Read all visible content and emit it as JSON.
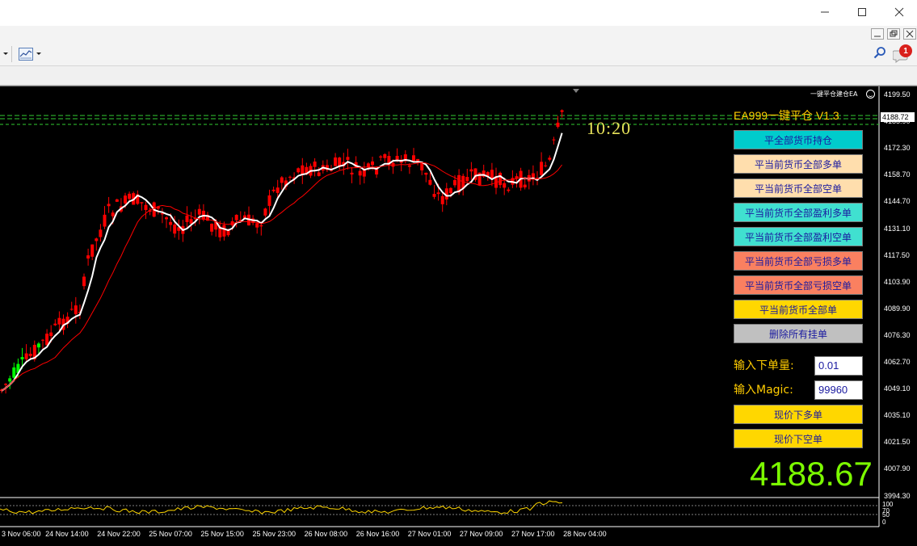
{
  "window": {
    "minimize_label": "—",
    "maximize_label": "☐",
    "close_label": "✕"
  },
  "toolbar": {
    "chart_type_icon": "line-chart-icon",
    "search_icon": "search-icon",
    "notifications_count": "1"
  },
  "chart": {
    "price_ticks": [
      "4199.50",
      "4185.90",
      "4172.30",
      "4158.70",
      "4144.70",
      "4131.10",
      "4117.50",
      "4103.90",
      "4089.90",
      "4076.30",
      "4062.70",
      "4049.10",
      "4035.10",
      "4021.50",
      "4007.90",
      "3994.30"
    ],
    "current_price_tag": "4188.72",
    "oscillator_ticks": [
      "100",
      "70",
      "50",
      "0"
    ],
    "time_ticks": [
      "3 Nov 06:00",
      "24 Nov 14:00",
      "24 Nov 22:00",
      "25 Nov 07:00",
      "25 Nov 15:00",
      "25 Nov 23:00",
      "26 Nov 08:00",
      "26 Nov 16:00",
      "27 Nov 01:00",
      "27 Nov 09:00",
      "27 Nov 17:00",
      "28 Nov 04:00"
    ],
    "colors": {
      "bull_candle": "#00ff00",
      "bear_candle": "#ff0000",
      "fast_ma": "#ffffff",
      "slow_ma": "#ff0000",
      "level_lines": "#32cd32",
      "oscillator": "#ffd700"
    }
  },
  "ea": {
    "small_label": "一键平仓建仓EA",
    "title": "EA999一键平仓 V1.3",
    "clock": "10:20",
    "buttons": [
      {
        "label": "平全部货币持仓",
        "bg": "#00cccc"
      },
      {
        "label": "平当前货币全部多单",
        "bg": "#ffdead"
      },
      {
        "label": "平当前货币全部空单",
        "bg": "#ffdead"
      },
      {
        "label": "平当前货币全部盈利多单",
        "bg": "#40e0d0"
      },
      {
        "label": "平当前货币全部盈利空单",
        "bg": "#40e0d0"
      },
      {
        "label": "平当前货币全部亏损多单",
        "bg": "#fa8060"
      },
      {
        "label": "平当前货币全部亏损空单",
        "bg": "#fa8060"
      },
      {
        "label": "平当前货币全部单",
        "bg": "#ffd700"
      },
      {
        "label": "删除所有挂单",
        "bg": "#c0c0c0"
      }
    ],
    "lot_label": "输入下单量:",
    "lot_value": "0.01",
    "magic_label": "输入Magic:",
    "magic_value": "99960",
    "buy_button": "现价下多单",
    "sell_button": "现价下空单",
    "big_price": "4188.67"
  }
}
